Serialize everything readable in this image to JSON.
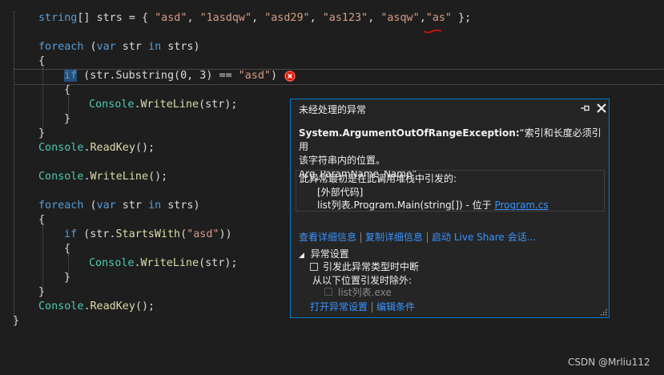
{
  "code": {
    "line1": {
      "t1": "string",
      "t2": "[] strs = { ",
      "s1": "\"asd\"",
      "c1": ", ",
      "s2": "\"1asdqw\"",
      "c2": ", ",
      "s3": "\"asd29\"",
      "c3": ", ",
      "s4": "\"as123\"",
      "c4": ", ",
      "s5": "\"asqw\"",
      "c5": ",",
      "s6": "\"as\"",
      "end": " };"
    },
    "foreach1": {
      "kw": "foreach",
      "p1": " (",
      "var": "var",
      "p2": " str ",
      "in": "in",
      "p3": " strs)"
    },
    "brace_open": "{",
    "brace_close": "}",
    "if1": {
      "kw": "if",
      "rest": " (str.Substring(0, 3) == ",
      "str": "\"asd\"",
      "close": ")"
    },
    "writeline_str": {
      "cls": "Console",
      "dot": ".",
      "m": "WriteLine",
      "args": "(str);"
    },
    "readkey": {
      "cls": "Console",
      "dot": ".",
      "m": "ReadKey",
      "args": "();"
    },
    "writeline_empty": {
      "cls": "Console",
      "dot": ".",
      "m": "WriteLine",
      "args": "();"
    },
    "foreach2": {
      "kw": "foreach",
      "p1": " (",
      "var": "var",
      "p2": " str ",
      "in": "in",
      "p3": " strs)"
    },
    "if2": {
      "kw": "if",
      "p1": " (str.",
      "m": "StartsWith",
      "p2": "(",
      "str": "\"asd\"",
      "p3": "))"
    }
  },
  "popup": {
    "title": "未经处理的异常",
    "exception_type": "System.ArgumentOutOfRangeException:",
    "message_line1": "“索引和长度必须引用",
    "message_line2": "该字符串内的位置。",
    "message_line3": "Arg_ParamName_Name”",
    "stack_header": "此异常最初是在此调用堆栈中引发的:",
    "stack_frame1": "[外部代码]",
    "stack_frame2_prefix": "list列表.Program.Main(string[]) - 位于 ",
    "stack_frame2_link": "Program.cs",
    "link_view_details": "查看详细信息",
    "link_copy_details": "复制详细信息",
    "link_live_share": "启动 Live Share 会话...",
    "settings_header": "异常设置",
    "break_when_thrown": "引发此异常类型时中断",
    "except_when_from": "从以下位置引发时除外:",
    "excluded_module": "list列表.exe",
    "link_open_settings": "打开异常设置",
    "link_edit_conditions": "编辑条件",
    "break_checked": false,
    "module_checked": false
  },
  "watermark": "CSDN @Mrliu112",
  "colors": {
    "accent": "#007acc",
    "error": "#e51400",
    "link": "#3794ff"
  }
}
